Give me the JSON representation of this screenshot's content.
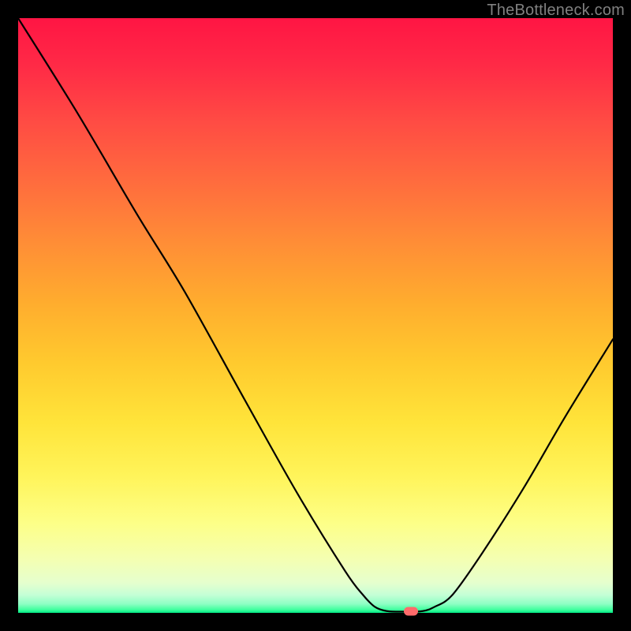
{
  "watermark": "TheBottleneck.com",
  "chart_data": {
    "type": "line",
    "title": "",
    "xlabel": "",
    "ylabel": "",
    "xlim": [
      0,
      100
    ],
    "ylim": [
      0,
      100
    ],
    "grid": false,
    "curve": [
      {
        "x": 0,
        "y": 100
      },
      {
        "x": 10,
        "y": 84
      },
      {
        "x": 20,
        "y": 67
      },
      {
        "x": 28,
        "y": 54
      },
      {
        "x": 38,
        "y": 36
      },
      {
        "x": 47,
        "y": 20
      },
      {
        "x": 55,
        "y": 7
      },
      {
        "x": 58,
        "y": 3
      },
      {
        "x": 60,
        "y": 1
      },
      {
        "x": 62,
        "y": 0.3
      },
      {
        "x": 65,
        "y": 0.2
      },
      {
        "x": 68,
        "y": 0.3
      },
      {
        "x": 70,
        "y": 1
      },
      {
        "x": 73,
        "y": 3
      },
      {
        "x": 78,
        "y": 10
      },
      {
        "x": 85,
        "y": 21
      },
      {
        "x": 92,
        "y": 33
      },
      {
        "x": 100,
        "y": 46
      }
    ],
    "marker": {
      "x": 66,
      "y": 0.3,
      "color": "#ff6b6b"
    },
    "colors": {
      "curve": "#000000",
      "background_top": "#ff1544",
      "background_bottom": "#00e884"
    }
  }
}
